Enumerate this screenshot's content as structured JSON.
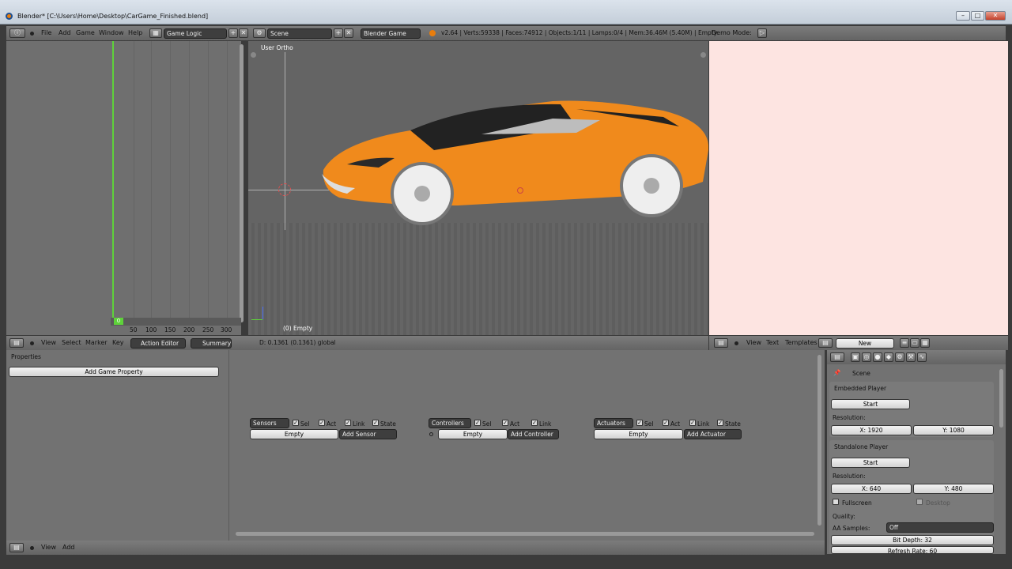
{
  "window": {
    "title": "Blender* [C:\\Users\\Home\\Desktop\\CarGame_Finished.blend]",
    "minimize": "–",
    "maximize": "□",
    "close": "✕"
  },
  "topbar": {
    "menus": [
      "File",
      "Add",
      "Game",
      "Window",
      "Help"
    ],
    "screen_layout": "Game Logic",
    "scene": "Scene",
    "engine": "Blender Game",
    "stats": "v2.64 | Verts:59338 | Faces:74912 | Objects:1/11 | Lamps:0/4 | Mem:36.46M (5.40M) | Empty",
    "demo_mode": "Demo Mode:"
  },
  "action_editor": {
    "frame_marker": "0",
    "ruler": [
      "50",
      "100",
      "150",
      "200",
      "250",
      "300"
    ],
    "menus": [
      "View",
      "Select",
      "Marker",
      "Key"
    ],
    "mode": "Action Editor",
    "summary": "Summary"
  },
  "viewport": {
    "view_label": "User Ortho",
    "object_label": "(0) Empty",
    "status": "D: 0.1361 (0.1361) global"
  },
  "text_editor": {
    "menus": [
      "View",
      "Text",
      "Templates"
    ],
    "new_label": "New"
  },
  "logic_editor": {
    "properties_title": "Properties",
    "add_property": "Add Game Property",
    "sensors": {
      "label": "Sensors",
      "sel": "Sel",
      "act": "Act",
      "link": "Link",
      "state": "State",
      "object": "Empty",
      "add": "Add Sensor"
    },
    "controllers": {
      "label": "Controllers",
      "sel": "Sel",
      "act": "Act",
      "link": "Link",
      "object": "Empty",
      "add": "Add Controller"
    },
    "actuators": {
      "label": "Actuators",
      "sel": "Sel",
      "act": "Act",
      "link": "Link",
      "state": "State",
      "object": "Empty",
      "add": "Add Actuator"
    },
    "menus": [
      "View",
      "Add"
    ]
  },
  "render_props": {
    "scene": "Scene",
    "embedded": {
      "title": "Embedded Player",
      "start": "Start",
      "resolution": "Resolution:",
      "x": "X: 1920",
      "y": "Y: 1080"
    },
    "standalone": {
      "title": "Standalone Player",
      "start": "Start",
      "resolution": "Resolution:",
      "x": "X: 640",
      "y": "Y: 480",
      "fullscreen": "Fullscreen",
      "desktop": "Desktop"
    },
    "quality": "Quality:",
    "aa_label": "AA Samples:",
    "aa_value": "Off",
    "bit_depth": "Bit Depth: 32",
    "refresh": "Refresh Rate: 60"
  },
  "colors": {
    "car_body": "#f08a1c",
    "frame_marker": "#5ed23a",
    "background": "#727272"
  }
}
